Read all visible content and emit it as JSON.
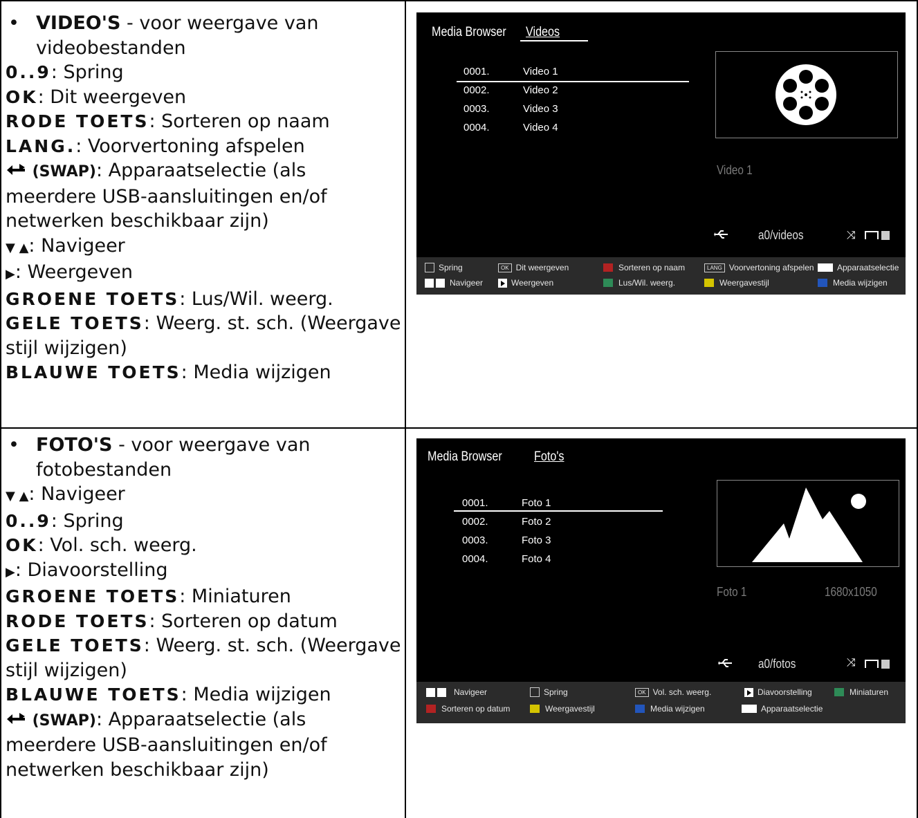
{
  "video_section": {
    "lines": [
      {
        "bold": "VIDEO'S",
        "text": " - voor weergave van"
      },
      {
        "text": "videobestanden"
      },
      {
        "key": "0..9",
        "text": ": Spring"
      },
      {
        "key": "OK",
        "text": ": Dit weergeven"
      },
      {
        "key": "RODE TOETS",
        "text": ": Sorteren op naam"
      },
      {
        "key": "LANG.",
        "text": ": Voorvertoning afspelen"
      },
      {
        "swap": "(SWAP)",
        "text": ": Apparaatselectie (als"
      },
      {
        "text": "meerdere USB-aansluitingen en/of"
      },
      {
        "text": "netwerken beschikbaar zijn)"
      },
      {
        "text": ": Navigeer"
      },
      {
        "text": ": Weergeven"
      },
      {
        "key": "GROENE TOETS",
        "text": ": Lus/Wil. weerg."
      },
      {
        "key": "GELE TOETS",
        "text": ": Weerg. st. sch. (Weergave"
      },
      {
        "text": "stijl wijzigen)"
      },
      {
        "key": "BLAUWE TOETS",
        "text": ": Media wijzigen"
      }
    ],
    "screen": {
      "title": "Media Browser",
      "tab": "Videos",
      "items": [
        {
          "num": "0001.",
          "name": "Video 1"
        },
        {
          "num": "0002.",
          "name": "Video 2"
        },
        {
          "num": "0003.",
          "name": "Video 3"
        },
        {
          "num": "0004.",
          "name": "Video 4"
        }
      ],
      "caption": "Video 1",
      "path": "a0/videos",
      "legend": [
        {
          "icon": "grid",
          "label": "Spring"
        },
        {
          "icon": "ok",
          "label": "Dit weergeven"
        },
        {
          "icon": "red",
          "label": "Sorteren op naam"
        },
        {
          "icon": "lang",
          "label": "Voorvertoning afspelen"
        },
        {
          "icon": "swap",
          "label": "Apparaatselectie"
        },
        {
          "icon": "nav",
          "label": "Navigeer"
        },
        {
          "icon": "play",
          "label": "Weergeven"
        },
        {
          "icon": "green",
          "label": "Lus/Wil. weerg."
        },
        {
          "icon": "yellow",
          "label": "Weergavestijl"
        },
        {
          "icon": "blue",
          "label": "Media wijzigen"
        }
      ]
    }
  },
  "photo_section": {
    "lines": [
      {
        "bold": "FOTO'S",
        "text": " - voor weergave van"
      },
      {
        "text": "fotobestanden"
      },
      {
        "text": ": Navigeer"
      },
      {
        "key": "0..9",
        "text": ": Spring"
      },
      {
        "key": "OK",
        "text": ": Vol. sch. weerg."
      },
      {
        "text": ": Diavoorstelling"
      },
      {
        "key": "GROENE TOETS",
        "text": ": Miniaturen"
      },
      {
        "key": "RODE TOETS",
        "text": ": Sorteren op datum"
      },
      {
        "key": "GELE TOETS",
        "text": ": Weerg. st. sch. (Weergave"
      },
      {
        "text": "stijl wijzigen)"
      },
      {
        "key": "BLAUWE TOETS",
        "text": ": Media wijzigen"
      },
      {
        "swap": "(SWAP)",
        "text": ": Apparaatselectie (als"
      },
      {
        "text": "meerdere USB-aansluitingen en/of"
      },
      {
        "text": "netwerken beschikbaar zijn)"
      }
    ],
    "screen": {
      "title": "Media Browser",
      "tab": "Foto's",
      "items": [
        {
          "num": "0001.",
          "name": "Foto 1"
        },
        {
          "num": "0002.",
          "name": "Foto 2"
        },
        {
          "num": "0003.",
          "name": "Foto 3"
        },
        {
          "num": "0004.",
          "name": "Foto 4"
        }
      ],
      "caption": "Foto 1",
      "resolution": "1680x1050",
      "path": "a0/fotos",
      "legend": [
        {
          "icon": "nav",
          "label": "Navigeer"
        },
        {
          "icon": "grid",
          "label": "Spring"
        },
        {
          "icon": "ok",
          "label": "Vol. sch. weerg."
        },
        {
          "icon": "play",
          "label": "Diavoorstelling"
        },
        {
          "icon": "green",
          "label": "Miniaturen"
        },
        {
          "icon": "red",
          "label": "Sorteren op datum"
        },
        {
          "icon": "yellow",
          "label": "Weergavestijl"
        },
        {
          "icon": "blue",
          "label": "Media wijzigen"
        },
        {
          "icon": "swap",
          "label": "Apparaatselectie"
        }
      ]
    }
  },
  "colors": {
    "red": "#b22222",
    "green": "#2e8b57",
    "yellow": "#d4c400",
    "blue": "#2255bb",
    "screen_bg": "#000000",
    "legend_bg": "#2b2b2b"
  },
  "ok_key": "OK",
  "lang_key": "LANG"
}
